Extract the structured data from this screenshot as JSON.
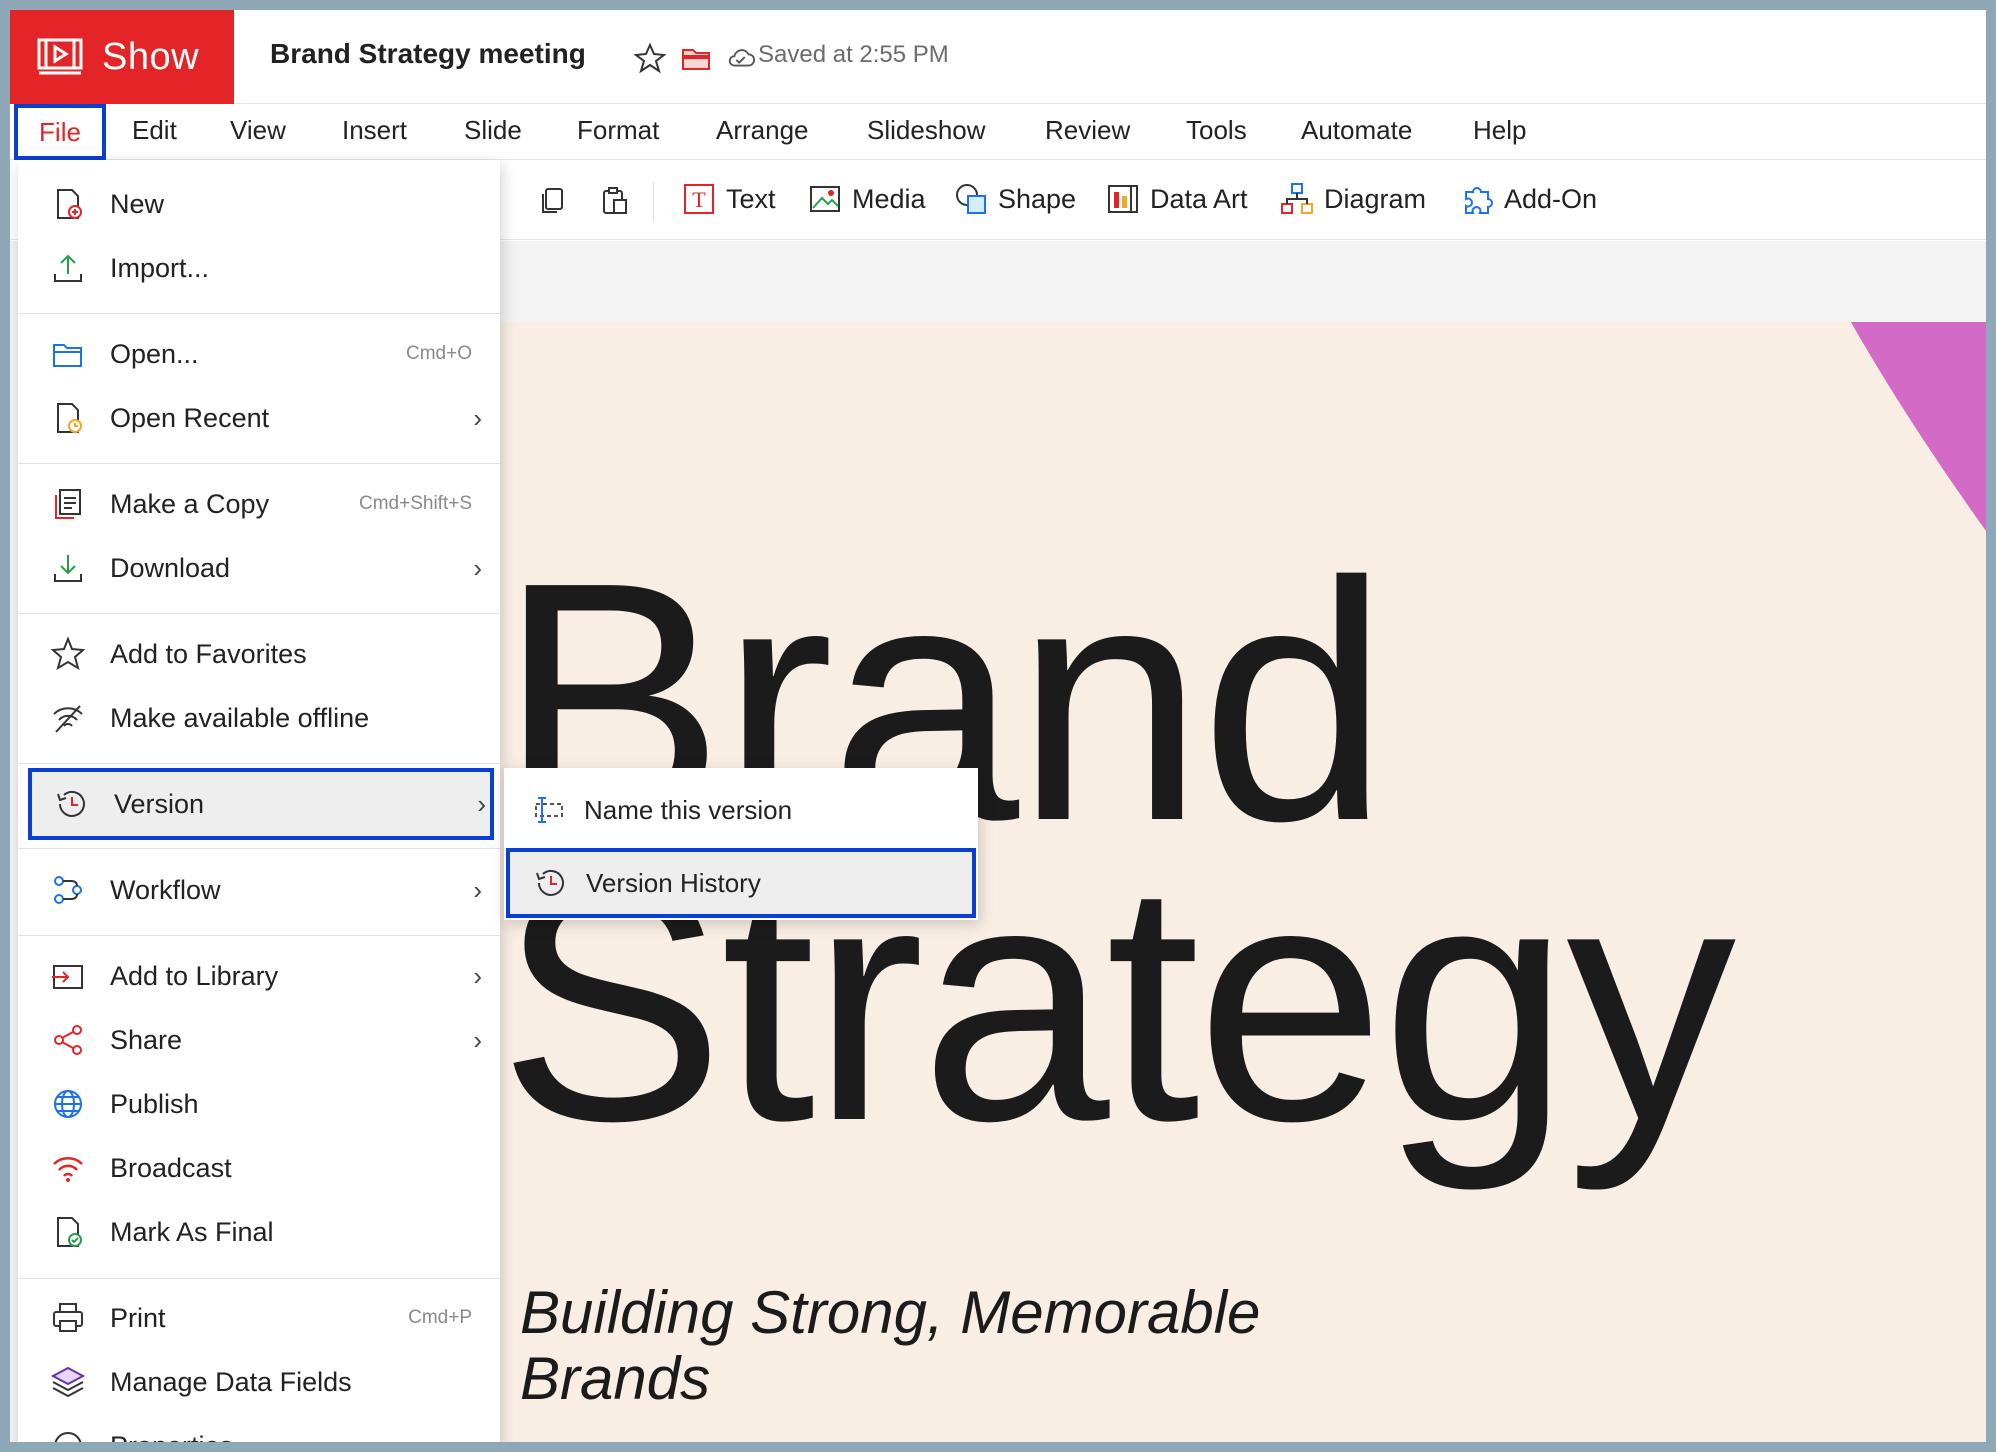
{
  "app": {
    "name": "Show",
    "document_title": "Brand Strategy meeting",
    "saved_status": "Saved at 2:55 PM"
  },
  "menubar": {
    "items": [
      "File",
      "Edit",
      "View",
      "Insert",
      "Slide",
      "Format",
      "Arrange",
      "Slideshow",
      "Review",
      "Tools",
      "Automate",
      "Help"
    ]
  },
  "toolbar": {
    "text": "Text",
    "media": "Media",
    "shape": "Shape",
    "data_art": "Data Art",
    "diagram": "Diagram",
    "add_on": "Add-On"
  },
  "file_menu": {
    "new": "New",
    "import": "Import...",
    "open": "Open...",
    "open_shortcut": "Cmd+O",
    "open_recent": "Open Recent",
    "make_copy": "Make a Copy",
    "make_copy_shortcut": "Cmd+Shift+S",
    "download": "Download",
    "add_favorites": "Add to Favorites",
    "offline": "Make available offline",
    "version": "Version",
    "workflow": "Workflow",
    "add_library": "Add to Library",
    "share": "Share",
    "publish": "Publish",
    "broadcast": "Broadcast",
    "mark_final": "Mark As Final",
    "print": "Print",
    "print_shortcut": "Cmd+P",
    "manage_data": "Manage Data Fields",
    "properties": "Properties",
    "chevron": "›"
  },
  "version_submenu": {
    "name_version": "Name this version",
    "version_history": "Version History"
  },
  "slide": {
    "title_line1": "Brand",
    "title_line2": "Strategy",
    "subtitle": "Building Strong, Memorable Brands"
  },
  "colors": {
    "brand_red": "#e42527",
    "highlight_blue": "#0a3fd4",
    "slide_bg": "#f8eee4",
    "accent_magenta": "#d46ac8"
  }
}
